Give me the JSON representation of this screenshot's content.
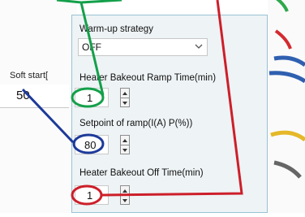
{
  "background": {
    "soft_start_label": "Soft start[",
    "soft_start_value": "50"
  },
  "panel": {
    "warmup_label": "Warm-up strategy",
    "warmup_value": "OFF",
    "ramp_time_label": "Heater Bakeout Ramp Time(min)",
    "ramp_time_value": "1",
    "setpoint_label": "Setpoint of ramp(I(A) P(%))",
    "setpoint_value": "80",
    "off_time_label": "Heater Bakeout Off Time(min)",
    "off_time_value": "1"
  },
  "annotation_colors": {
    "green": "#14a04a",
    "blue": "#1d3a9a",
    "red": "#cc1f2a"
  }
}
